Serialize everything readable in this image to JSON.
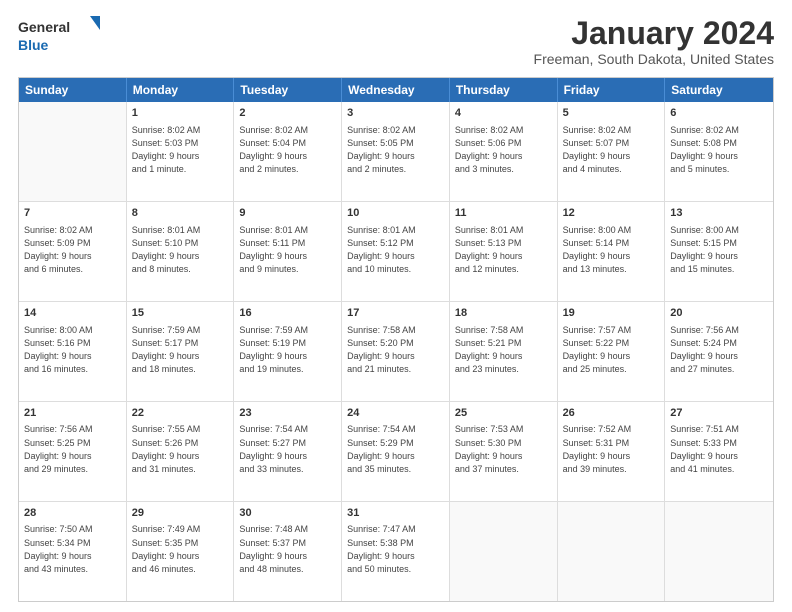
{
  "header": {
    "logo": {
      "text_general": "General",
      "text_blue": "Blue"
    },
    "title": "January 2024",
    "location": "Freeman, South Dakota, United States"
  },
  "calendar": {
    "days_of_week": [
      "Sunday",
      "Monday",
      "Tuesday",
      "Wednesday",
      "Thursday",
      "Friday",
      "Saturday"
    ],
    "weeks": [
      [
        {
          "day": "",
          "empty": true
        },
        {
          "day": "1",
          "line1": "Sunrise: 8:02 AM",
          "line2": "Sunset: 5:03 PM",
          "line3": "Daylight: 9 hours",
          "line4": "and 1 minute."
        },
        {
          "day": "2",
          "line1": "Sunrise: 8:02 AM",
          "line2": "Sunset: 5:04 PM",
          "line3": "Daylight: 9 hours",
          "line4": "and 2 minutes."
        },
        {
          "day": "3",
          "line1": "Sunrise: 8:02 AM",
          "line2": "Sunset: 5:05 PM",
          "line3": "Daylight: 9 hours",
          "line4": "and 2 minutes."
        },
        {
          "day": "4",
          "line1": "Sunrise: 8:02 AM",
          "line2": "Sunset: 5:06 PM",
          "line3": "Daylight: 9 hours",
          "line4": "and 3 minutes."
        },
        {
          "day": "5",
          "line1": "Sunrise: 8:02 AM",
          "line2": "Sunset: 5:07 PM",
          "line3": "Daylight: 9 hours",
          "line4": "and 4 minutes."
        },
        {
          "day": "6",
          "line1": "Sunrise: 8:02 AM",
          "line2": "Sunset: 5:08 PM",
          "line3": "Daylight: 9 hours",
          "line4": "and 5 minutes."
        }
      ],
      [
        {
          "day": "7",
          "line1": "Sunrise: 8:02 AM",
          "line2": "Sunset: 5:09 PM",
          "line3": "Daylight: 9 hours",
          "line4": "and 6 minutes."
        },
        {
          "day": "8",
          "line1": "Sunrise: 8:01 AM",
          "line2": "Sunset: 5:10 PM",
          "line3": "Daylight: 9 hours",
          "line4": "and 8 minutes."
        },
        {
          "day": "9",
          "line1": "Sunrise: 8:01 AM",
          "line2": "Sunset: 5:11 PM",
          "line3": "Daylight: 9 hours",
          "line4": "and 9 minutes."
        },
        {
          "day": "10",
          "line1": "Sunrise: 8:01 AM",
          "line2": "Sunset: 5:12 PM",
          "line3": "Daylight: 9 hours",
          "line4": "and 10 minutes."
        },
        {
          "day": "11",
          "line1": "Sunrise: 8:01 AM",
          "line2": "Sunset: 5:13 PM",
          "line3": "Daylight: 9 hours",
          "line4": "and 12 minutes."
        },
        {
          "day": "12",
          "line1": "Sunrise: 8:00 AM",
          "line2": "Sunset: 5:14 PM",
          "line3": "Daylight: 9 hours",
          "line4": "and 13 minutes."
        },
        {
          "day": "13",
          "line1": "Sunrise: 8:00 AM",
          "line2": "Sunset: 5:15 PM",
          "line3": "Daylight: 9 hours",
          "line4": "and 15 minutes."
        }
      ],
      [
        {
          "day": "14",
          "line1": "Sunrise: 8:00 AM",
          "line2": "Sunset: 5:16 PM",
          "line3": "Daylight: 9 hours",
          "line4": "and 16 minutes."
        },
        {
          "day": "15",
          "line1": "Sunrise: 7:59 AM",
          "line2": "Sunset: 5:17 PM",
          "line3": "Daylight: 9 hours",
          "line4": "and 18 minutes."
        },
        {
          "day": "16",
          "line1": "Sunrise: 7:59 AM",
          "line2": "Sunset: 5:19 PM",
          "line3": "Daylight: 9 hours",
          "line4": "and 19 minutes."
        },
        {
          "day": "17",
          "line1": "Sunrise: 7:58 AM",
          "line2": "Sunset: 5:20 PM",
          "line3": "Daylight: 9 hours",
          "line4": "and 21 minutes."
        },
        {
          "day": "18",
          "line1": "Sunrise: 7:58 AM",
          "line2": "Sunset: 5:21 PM",
          "line3": "Daylight: 9 hours",
          "line4": "and 23 minutes."
        },
        {
          "day": "19",
          "line1": "Sunrise: 7:57 AM",
          "line2": "Sunset: 5:22 PM",
          "line3": "Daylight: 9 hours",
          "line4": "and 25 minutes."
        },
        {
          "day": "20",
          "line1": "Sunrise: 7:56 AM",
          "line2": "Sunset: 5:24 PM",
          "line3": "Daylight: 9 hours",
          "line4": "and 27 minutes."
        }
      ],
      [
        {
          "day": "21",
          "line1": "Sunrise: 7:56 AM",
          "line2": "Sunset: 5:25 PM",
          "line3": "Daylight: 9 hours",
          "line4": "and 29 minutes."
        },
        {
          "day": "22",
          "line1": "Sunrise: 7:55 AM",
          "line2": "Sunset: 5:26 PM",
          "line3": "Daylight: 9 hours",
          "line4": "and 31 minutes."
        },
        {
          "day": "23",
          "line1": "Sunrise: 7:54 AM",
          "line2": "Sunset: 5:27 PM",
          "line3": "Daylight: 9 hours",
          "line4": "and 33 minutes."
        },
        {
          "day": "24",
          "line1": "Sunrise: 7:54 AM",
          "line2": "Sunset: 5:29 PM",
          "line3": "Daylight: 9 hours",
          "line4": "and 35 minutes."
        },
        {
          "day": "25",
          "line1": "Sunrise: 7:53 AM",
          "line2": "Sunset: 5:30 PM",
          "line3": "Daylight: 9 hours",
          "line4": "and 37 minutes."
        },
        {
          "day": "26",
          "line1": "Sunrise: 7:52 AM",
          "line2": "Sunset: 5:31 PM",
          "line3": "Daylight: 9 hours",
          "line4": "and 39 minutes."
        },
        {
          "day": "27",
          "line1": "Sunrise: 7:51 AM",
          "line2": "Sunset: 5:33 PM",
          "line3": "Daylight: 9 hours",
          "line4": "and 41 minutes."
        }
      ],
      [
        {
          "day": "28",
          "line1": "Sunrise: 7:50 AM",
          "line2": "Sunset: 5:34 PM",
          "line3": "Daylight: 9 hours",
          "line4": "and 43 minutes."
        },
        {
          "day": "29",
          "line1": "Sunrise: 7:49 AM",
          "line2": "Sunset: 5:35 PM",
          "line3": "Daylight: 9 hours",
          "line4": "and 46 minutes."
        },
        {
          "day": "30",
          "line1": "Sunrise: 7:48 AM",
          "line2": "Sunset: 5:37 PM",
          "line3": "Daylight: 9 hours",
          "line4": "and 48 minutes."
        },
        {
          "day": "31",
          "line1": "Sunrise: 7:47 AM",
          "line2": "Sunset: 5:38 PM",
          "line3": "Daylight: 9 hours",
          "line4": "and 50 minutes."
        },
        {
          "day": "",
          "empty": true
        },
        {
          "day": "",
          "empty": true
        },
        {
          "day": "",
          "empty": true
        }
      ]
    ]
  }
}
